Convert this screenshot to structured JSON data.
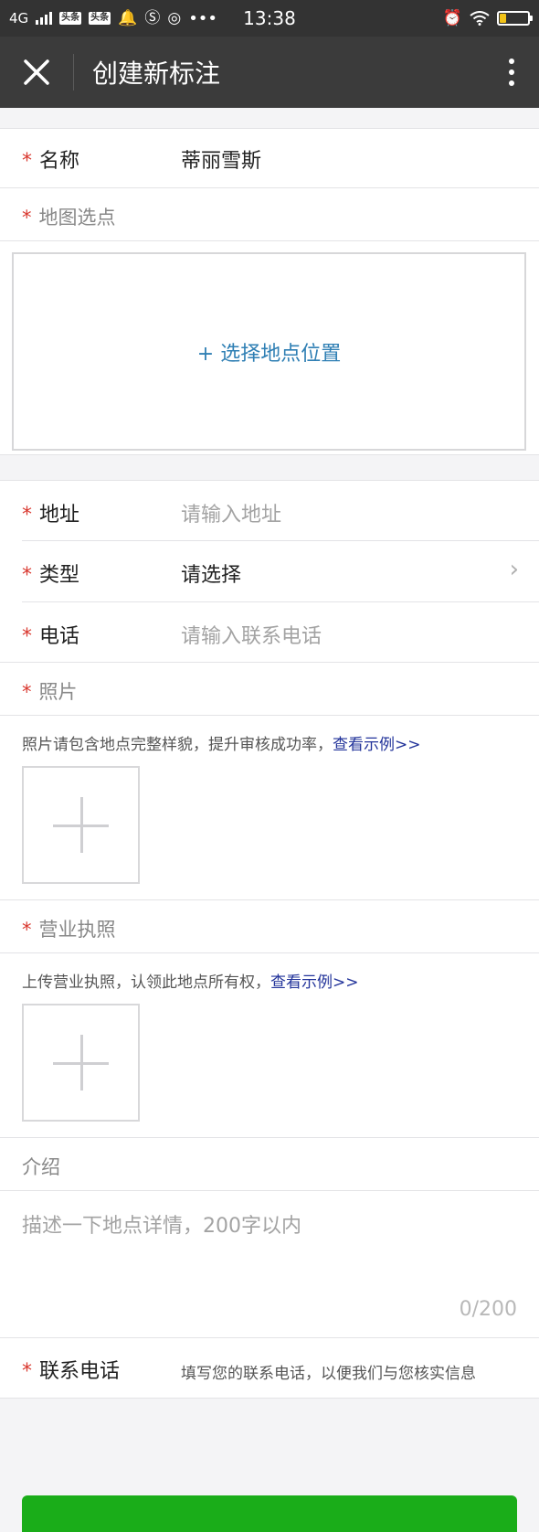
{
  "status_bar": {
    "network": "4G",
    "app_badges": [
      "头条",
      "头条"
    ],
    "time": "13:38",
    "dots": "•••"
  },
  "nav": {
    "title": "创建新标注"
  },
  "form": {
    "required_mark": "*",
    "name": {
      "label": "名称",
      "value": "蒂丽雪斯"
    },
    "map": {
      "label": "地图选点",
      "button": "+ 选择地点位置"
    },
    "address": {
      "label": "地址",
      "placeholder": "请输入地址"
    },
    "type": {
      "label": "类型",
      "value": "请选择"
    },
    "phone": {
      "label": "电话",
      "placeholder": "请输入联系电话"
    },
    "photo": {
      "label": "照片",
      "hint": "照片请包含地点完整样貌，提升审核成功率，",
      "link": "查看示例>>"
    },
    "license": {
      "label": "营业执照",
      "hint": "上传营业执照，认领此地点所有权，",
      "link": "查看示例>>"
    },
    "intro": {
      "label": "介绍",
      "placeholder": "描述一下地点详情，200字以内",
      "counter": "0/200"
    },
    "contact": {
      "label": "联系电话",
      "hint": "填写您的联系电话，以便我们与您核实信息"
    }
  },
  "colors": {
    "required": "#d9382f",
    "link": "#22339a",
    "map_button": "#2f7fb4",
    "submit": "#1aad19",
    "navbar": "#3b3b3b"
  }
}
